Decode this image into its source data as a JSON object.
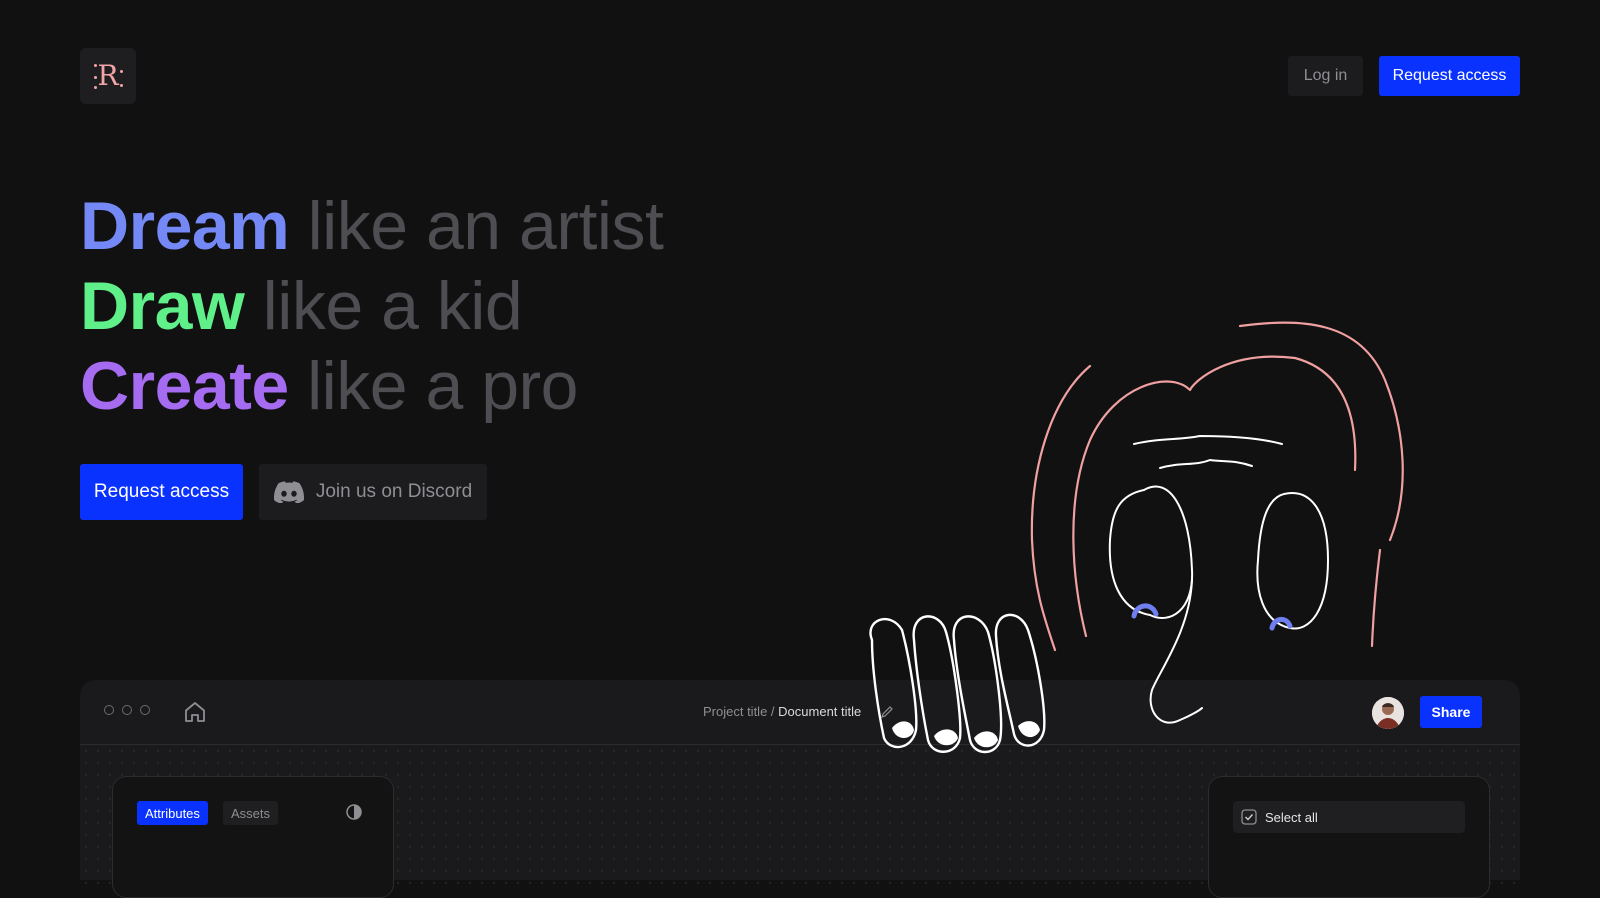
{
  "header": {
    "logo_letter": "R",
    "login_label": "Log in",
    "request_access_label": "Request access"
  },
  "hero": {
    "lines": [
      {
        "strong": "Dream",
        "rest": " like an artist",
        "color": "#7489f5"
      },
      {
        "strong": "Draw",
        "rest": " like a kid",
        "color": "#5ff08a"
      },
      {
        "strong": "Create",
        "rest": " like a pro",
        "color": "#a56cf1"
      }
    ]
  },
  "cta": {
    "primary_label": "Request access",
    "discord_label": "Join us on Discord",
    "discord_icon": "discord-icon"
  },
  "app_preview": {
    "breadcrumb_project": "Project title",
    "breadcrumb_separator": " / ",
    "breadcrumb_document": "Document title",
    "share_label": "Share",
    "tabs": [
      "Attributes",
      "Assets"
    ],
    "select_all_label": "Select all"
  },
  "colors": {
    "background": "#111112",
    "accent": "#0a32ff",
    "doodle_hair": "#f0a0a0",
    "doodle_lines": "#ffffff",
    "doodle_pupils": "#6f7ff0"
  }
}
